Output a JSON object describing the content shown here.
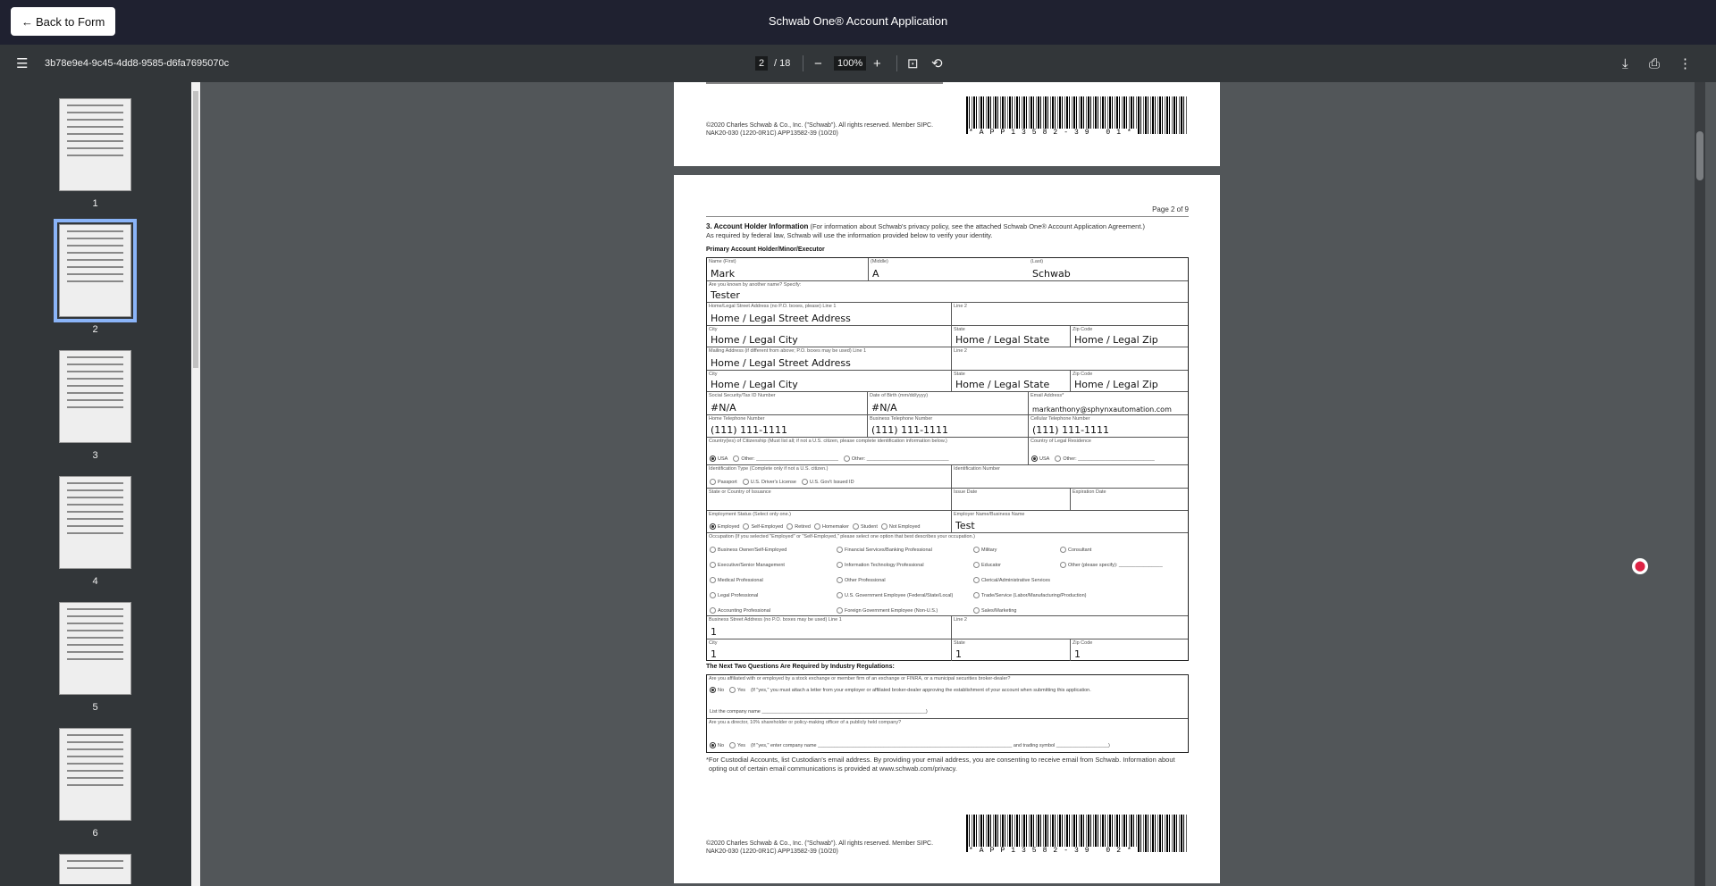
{
  "header": {
    "back_label": "Back to Form",
    "title": "Schwab One® Account Application"
  },
  "toolbar": {
    "doc_id": "3b78e9e4-9c45-4dd8-9585-d6fa7695070c",
    "page_current": "2",
    "page_total": "/ 18",
    "zoom": "100%"
  },
  "thumbnails": [
    {
      "label": "1"
    },
    {
      "label": "2",
      "selected": true
    },
    {
      "label": "3"
    },
    {
      "label": "4"
    },
    {
      "label": "5"
    },
    {
      "label": "6"
    }
  ],
  "footer": {
    "copyright": "©2020 Charles Schwab & Co., Inc. (\"Schwab\"). All rights reserved. Member SIPC.",
    "code": "NAK20-030 (1220-0R1C)   APP13582-39 (10/20)",
    "barcode1": "*APP13582-39 01*",
    "barcode2": "*APP13582-39 02*"
  },
  "page2": {
    "page_num": "Page 2 of 9",
    "section_title": "3. Account Holder Information",
    "section_note": "(For information about Schwab's privacy policy, see the attached Schwab One® Account Application Agreement.)",
    "section_line2": "As required by federal law, Schwab will use the information provided below to verify your identity.",
    "subheading": "Primary Account Holder/Minor/Executor",
    "fields": {
      "first_label": "Name (First)",
      "first": "Mark",
      "middle_label": "(Middle)",
      "middle": "A",
      "last_label": "(Last)",
      "last": "Schwab",
      "alias_label": "Are you known by another name? Specify:",
      "alias": "Tester",
      "home_addr_label": "Home/Legal Street Address (no P.O. boxes, please) Line 1",
      "home_addr": "Home / Legal Street Address",
      "line2_label": "Line 2",
      "city_label": "City",
      "home_city": "Home / Legal City",
      "state_label": "State",
      "home_state": "Home / Legal State",
      "zip_label": "Zip Code",
      "home_zip": "Home / Legal Zip",
      "mail_addr_label": "Mailing Address (if different from above; P.O. boxes may be used) Line 1",
      "mail_addr": "Home / Legal Street Address",
      "mail_city": "Home / Legal City",
      "mail_state": "Home / Legal State",
      "mail_zip": "Home / Legal Zip",
      "ssn_label": "Social Security/Tax ID Number",
      "ssn": "#N/A",
      "dob_label": "Date of Birth (mm/dd/yyyy)",
      "dob": "#N/A",
      "email_label": "Email Address*",
      "email": "markanthony@sphynxautomation.com",
      "home_phone_label": "Home Telephone Number",
      "home_phone": "(111) 111-1111",
      "bus_phone_label": "Business Telephone Number",
      "bus_phone": "(111) 111-1111",
      "cell_label": "Cellular Telephone Number",
      "cell": "(111) 111-1111",
      "citizenship_label": "Country(ies) of Citizenship (Must list all; if not a U.S. citizen, please complete identification information below.)",
      "usa": "USA",
      "other": "Other:",
      "residence_label": "Country of Legal Residence",
      "idtype_label": "Identification Type (Complete only if not a U.S. citizen.)",
      "passport": "Passport",
      "license": "U.S. Driver's License",
      "govid": "U.S. Gov't Issued ID",
      "idnum_label": "Identification Number",
      "issuance_label": "State or Country of Issuance",
      "issue_label": "Issue Date",
      "exp_label": "Expiration Date",
      "emp_label": "Employment Status (Select only one.)",
      "emp_opts": [
        "Employed",
        "Self-Employed",
        "Retired",
        "Homemaker",
        "Student",
        "Not Employed"
      ],
      "employer_label": "Employer Name/Business Name",
      "employer": "Test",
      "occ_label": "Occupation (If you selected \"Employed\" or \"Self-Employed,\" please select one option that best describes your occupation.)",
      "occ_cols": [
        [
          "Business Owner/Self-Employed",
          "Executive/Senior Management",
          "Medical Professional",
          "Legal Professional",
          "Accounting Professional"
        ],
        [
          "Financial Services/Banking Professional",
          "Information Technology Professional",
          "Other Professional",
          "U.S. Government Employee (Federal/State/Local)",
          "Foreign Government Employee (Non-U.S.)"
        ],
        [
          "Military",
          "Educator",
          "Clerical/Administrative Services",
          "Trade/Service (Labor/Manufacturing/Production)",
          "Sales/Marketing"
        ],
        [
          "Consultant",
          "Other (please specify):"
        ]
      ],
      "bus_addr_label": "Business Street Address (no P.O. boxes may be used) Line 1",
      "bus_addr": "1",
      "bus_city": "1",
      "bus_state": "1",
      "bus_zip": "1"
    },
    "reg_heading": "The Next Two Questions Are Required by Industry Regulations:",
    "q1": "Are you affiliated with or employed by a stock exchange or member firm of an exchange or FINRA, or a municipal securities broker-dealer?",
    "no": "No",
    "yes": "Yes",
    "q1_note": "(If \"yes,\" you must attach a letter from your employer or affiliated broker-dealer approving the establishment of your account when submitting this application.",
    "q1_company": "List the company name ____________________________________________________________)",
    "q2": "Are you a director, 10% shareholder or policy-making officer of a publicly held company?",
    "q2_note": "(If \"yes,\" enter company name _______________________________________________________________________ and trading symbol ___________________)",
    "footnote": "*For Custodial Accounts, list Custodian's email address. By providing your email address, you are consenting to receive email from Schwab. Information about opting out of certain email communications is provided at www.schwab.com/privacy."
  }
}
